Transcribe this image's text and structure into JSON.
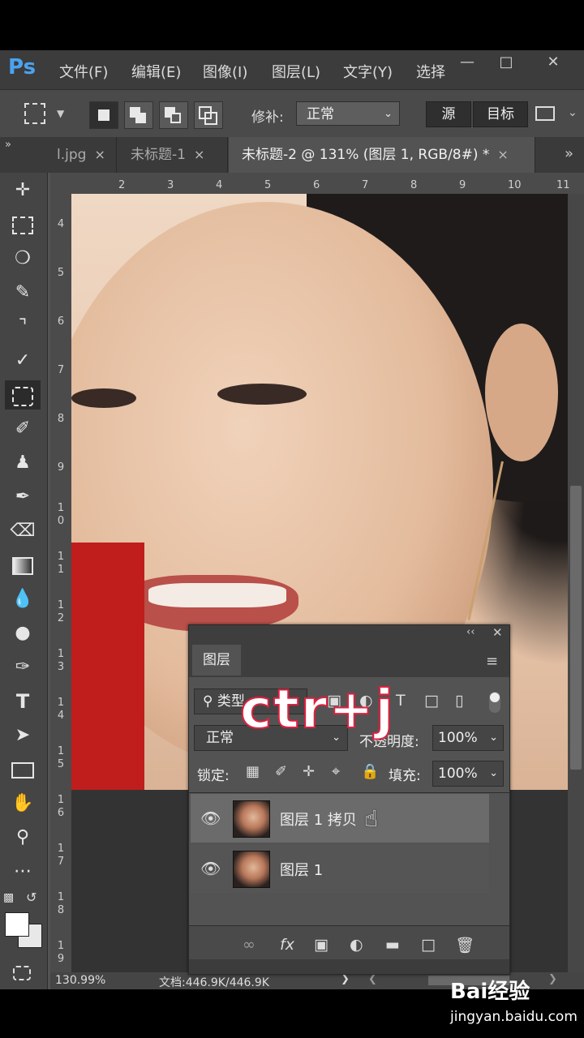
{
  "menu": {
    "logo": "Ps",
    "items": [
      "文件(F)",
      "编辑(E)",
      "图像(I)",
      "图层(L)",
      "文字(Y)",
      "选择"
    ]
  },
  "options_bar": {
    "patch_label": "修补:",
    "blend_mode": "正常",
    "source_label": "源",
    "target_label": "目标"
  },
  "tabs": [
    {
      "label": "l.jpg",
      "close": "×"
    },
    {
      "label": "未标题-1",
      "close": "×"
    },
    {
      "label": "未标题-2 @ 131% (图层 1, RGB/8#) *",
      "close": "×"
    }
  ],
  "tab_overflow": "»",
  "ruler": {
    "h_ticks": [
      "2",
      "3",
      "4",
      "5",
      "6",
      "7",
      "8",
      "9",
      "10",
      "11"
    ],
    "v_ticks": [
      "4",
      "5",
      "6",
      "7",
      "8",
      "9",
      "1\n0",
      "1\n1",
      "1\n2",
      "1\n3",
      "1\n4",
      "1\n5",
      "1\n6",
      "1\n7",
      "1\n8",
      "1\n9"
    ]
  },
  "status": {
    "zoom": "130.99%",
    "doc": "文档:446.9K/446.9K"
  },
  "layers_panel": {
    "title": "图层",
    "filter_label": "类型",
    "blend_mode": "正常",
    "opacity_label": "不透明度:",
    "opacity_value": "100%",
    "lock_label": "锁定:",
    "fill_label": "填充:",
    "fill_value": "100%",
    "layers": [
      {
        "name": "图层 1 拷贝",
        "selected": true
      },
      {
        "name": "图层 1",
        "selected": false
      }
    ],
    "bottom_icons": [
      "link-icon",
      "fx-icon",
      "mask-icon",
      "adjustment-icon",
      "folder-icon",
      "new-layer-icon",
      "trash-icon"
    ],
    "fx": "fx"
  },
  "overlay_text": "ctr+j",
  "watermark": {
    "brand": "Bai经验",
    "url": "jingyan.baidu.com"
  },
  "colors": {
    "accent": "#4aa3f0",
    "overlay_stroke": "#e02040"
  }
}
